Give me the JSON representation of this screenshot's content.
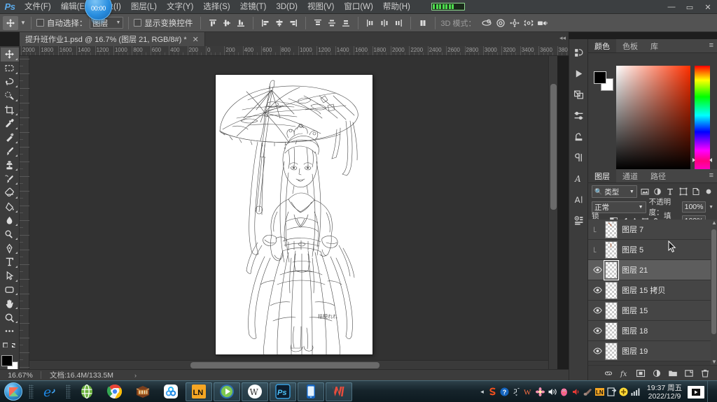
{
  "app": {
    "name": "Ps",
    "timer": "00:00"
  },
  "menubar": {
    "items": [
      {
        "label": "文件(F)"
      },
      {
        "label": "编辑(E)"
      },
      {
        "label": "图像(I)"
      },
      {
        "label": "图层(L)"
      },
      {
        "label": "文字(Y)"
      },
      {
        "label": "选择(S)"
      },
      {
        "label": "滤镜(T)"
      },
      {
        "label": "3D(D)"
      },
      {
        "label": "视图(V)"
      },
      {
        "label": "窗口(W)"
      },
      {
        "label": "帮助(H)"
      }
    ],
    "window_controls": {
      "minimize": "—",
      "maximize": "▭",
      "close": "✕"
    }
  },
  "options_bar": {
    "tool_icon": "move-tool-icon",
    "auto_select_label": "自动选择：",
    "auto_select_value": "图层",
    "show_transform_label": "显示变换控件",
    "mode3d_label": "3D 模式：",
    "align_icons": [
      "align-top-edges-icon",
      "align-vertical-centers-icon",
      "align-bottom-edges-icon",
      "align-left-edges-icon",
      "align-horizontal-centers-icon",
      "align-right-edges-icon"
    ],
    "align_icons2": [
      "distribute-top-icon",
      "distribute-vertical-center-icon",
      "distribute-bottom-icon",
      "distribute-left-icon",
      "distribute-horizontal-center-icon",
      "distribute-right-icon"
    ],
    "extra_icons": [
      "align-distribute-panel-icon"
    ],
    "mode3d_icons": [
      "orbit-3d-icon",
      "roll-3d-icon",
      "pan-3d-icon",
      "slide-3d-icon",
      "zoom-3d-icon"
    ]
  },
  "document": {
    "tab_title": "提升班作业1.psd @ 16.7% (图层 21, RGB/8#) *",
    "close_glyph": "✕"
  },
  "rulers": {
    "horizontal": [
      "2000",
      "1800",
      "1600",
      "1400",
      "1200",
      "1000",
      "800",
      "600",
      "400",
      "200",
      "0",
      "200",
      "400",
      "600",
      "800",
      "1000",
      "1200",
      "1400",
      "1600",
      "1800",
      "2000",
      "2200",
      "2400",
      "2600",
      "2800",
      "3000",
      "3200",
      "3400",
      "3600",
      "380"
    ],
    "unit": "px"
  },
  "toolbar": {
    "tools": [
      {
        "name": "move-tool",
        "icon": "move-icon",
        "active": true
      },
      {
        "name": "marquee-tool",
        "icon": "rectangular-marquee-icon",
        "active": false
      },
      {
        "name": "lasso-tool",
        "icon": "lasso-icon",
        "active": false
      },
      {
        "name": "quick-selection-tool",
        "icon": "quick-selection-icon",
        "active": false
      },
      {
        "name": "crop-tool",
        "icon": "crop-icon",
        "active": false
      },
      {
        "name": "eyedropper-tool",
        "icon": "eyedropper-icon",
        "active": false
      },
      {
        "name": "spot-healing-tool",
        "icon": "healing-brush-icon",
        "active": false
      },
      {
        "name": "brush-tool",
        "icon": "brush-icon",
        "active": false
      },
      {
        "name": "clone-stamp-tool",
        "icon": "clone-stamp-icon",
        "active": false
      },
      {
        "name": "history-brush-tool",
        "icon": "history-brush-icon",
        "active": false
      },
      {
        "name": "eraser-tool",
        "icon": "eraser-icon",
        "active": false
      },
      {
        "name": "gradient-tool",
        "icon": "paint-bucket-icon",
        "active": false
      },
      {
        "name": "blur-tool",
        "icon": "blur-drop-icon",
        "active": false
      },
      {
        "name": "dodge-tool",
        "icon": "dodge-icon",
        "active": false
      },
      {
        "name": "pen-tool",
        "icon": "pen-icon",
        "active": false
      },
      {
        "name": "type-tool",
        "icon": "type-T-icon",
        "active": false
      },
      {
        "name": "path-selection-tool",
        "icon": "path-arrow-icon",
        "active": false
      },
      {
        "name": "shape-tool",
        "icon": "rounded-rectangle-icon",
        "active": false
      },
      {
        "name": "hand-tool",
        "icon": "hand-icon",
        "active": false
      },
      {
        "name": "zoom-tool",
        "icon": "magnifier-icon",
        "active": false
      },
      {
        "name": "edit-toolbar",
        "icon": "ellipsis-icon",
        "active": false
      },
      {
        "name": "quick-mask",
        "icon": "quick-mask-icon",
        "active": false
      }
    ],
    "foreground_color": "#000000",
    "background_color": "#ffffff"
  },
  "icon_dock": {
    "items": [
      {
        "name": "history-panel-icon"
      },
      {
        "name": "actions-play-icon"
      },
      {
        "name": "properties-panel-icon"
      },
      {
        "name": "adjustments-panel-icon"
      },
      {
        "name": "libraries-panel-icon"
      },
      {
        "name": "paragraph-panel-icon"
      },
      {
        "name": "character-styles-icon"
      },
      {
        "name": "character-panel-icon"
      },
      {
        "name": "brush-presets-icon"
      }
    ]
  },
  "color_panel": {
    "tabs": [
      {
        "label": "颜色",
        "active": true
      },
      {
        "label": "色板",
        "active": false
      },
      {
        "label": "库",
        "active": false
      }
    ],
    "foreground": "#000000",
    "background": "#ffffff",
    "accent": "#ff3000"
  },
  "layers_panel": {
    "tabs": [
      {
        "label": "图层",
        "active": true
      },
      {
        "label": "通道",
        "active": false
      },
      {
        "label": "路径",
        "active": false
      }
    ],
    "filter_label": "类型",
    "filter_icons": [
      "pixel-filter-icon",
      "adjustment-filter-icon",
      "type-filter-icon",
      "shape-filter-icon",
      "smart-object-filter-icon",
      "filter-toggle-icon"
    ],
    "blend_mode": "正常",
    "opacity_label": "不透明度：",
    "opacity_value": "100%",
    "lock_label": "锁定：",
    "lock_icons": [
      "lock-transparent-pixels-icon",
      "lock-image-pixels-icon",
      "lock-position-icon",
      "lock-artboard-icon",
      "lock-all-icon"
    ],
    "fill_label": "填充：",
    "fill_value": "100%",
    "layers": [
      {
        "name": "图层 7",
        "visible": false,
        "selected": false
      },
      {
        "name": "图层 5",
        "visible": false,
        "selected": false
      },
      {
        "name": "图层 21",
        "visible": true,
        "selected": true
      },
      {
        "name": "图层 15 拷贝",
        "visible": true,
        "selected": false
      },
      {
        "name": "图层 15",
        "visible": true,
        "selected": false
      },
      {
        "name": "图层 18",
        "visible": true,
        "selected": false
      },
      {
        "name": "图层 19",
        "visible": true,
        "selected": false
      }
    ],
    "bottom_icons": [
      "link-layers-icon",
      "layer-style-fx-icon",
      "add-layer-mask-icon",
      "new-adjustment-layer-icon",
      "new-group-icon",
      "new-layer-icon",
      "delete-layer-icon"
    ]
  },
  "status_bar": {
    "zoom": "16.67%",
    "doc_info": "文档:16.4M/133.5M",
    "arrow": "›"
  },
  "taskbar": {
    "start": "windows-start-orb-icon",
    "items": [
      {
        "name": "internet-explorer-icon",
        "open": false
      },
      {
        "name": "green-browser-icon",
        "open": false
      },
      {
        "name": "google-chrome-icon",
        "open": false
      },
      {
        "name": "winrar-icon",
        "open": false
      },
      {
        "name": "cloud-sync-icon",
        "open": false
      },
      {
        "name": "ln-app-icon",
        "label": "LN",
        "open": true
      },
      {
        "name": "media-player-icon",
        "open": true
      },
      {
        "name": "w-circle-app-icon",
        "open": true
      },
      {
        "name": "photoshop-icon",
        "label": "Ps",
        "open": true
      },
      {
        "name": "phone-app-icon",
        "open": true
      },
      {
        "name": "wps-office-icon",
        "open": true
      }
    ],
    "tray_icons": [
      "sogou-input-icon",
      "help-icon",
      "network-share-icon",
      "w-tray-icon",
      "flower-icon",
      "volume-icon",
      "penguin-qq-icon",
      "red-speaker-icon",
      "violin-icon",
      "ln-tray-icon",
      "device-icon",
      "plus-circle-icon",
      "signal-bars-icon"
    ],
    "clock_time": "19:37 周五",
    "clock_date": "2022/12/9",
    "show_desktop": "show-desktop-button"
  },
  "artwork": {
    "description": "line-art sketch of a woman in traditional dress holding a parasol",
    "signature": "桔梗れれ"
  }
}
